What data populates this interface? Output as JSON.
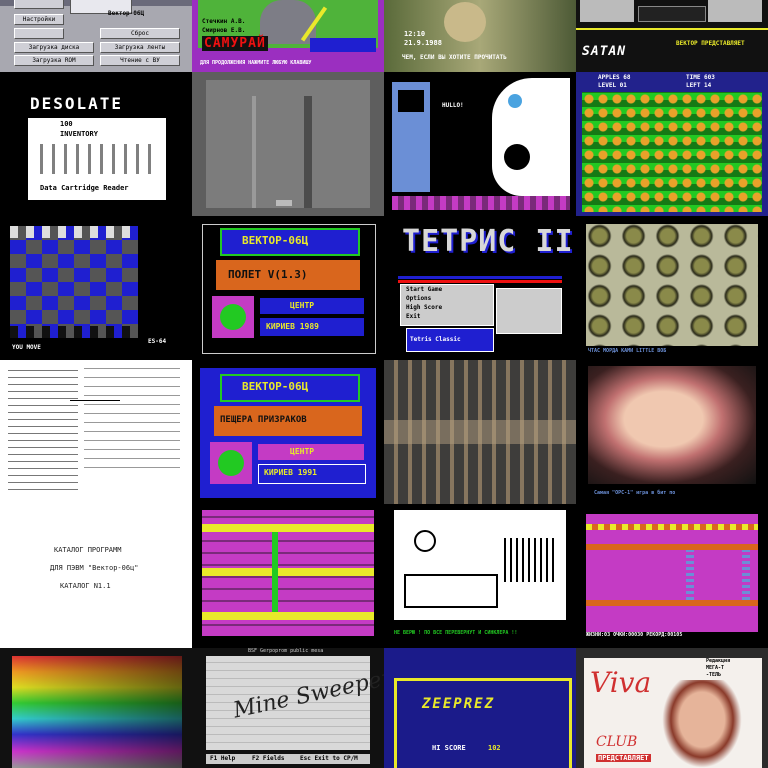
{
  "tiles": [
    {
      "id": "t1",
      "kind": "menu-screen",
      "title": "Вектор-06Ц",
      "buttons": [
        "Настройки",
        "Загрузка диска",
        "Загрузка ROM",
        "Сброс",
        "Загрузка ленты",
        "Чтение с ВУ"
      ]
    },
    {
      "id": "t2",
      "kind": "game",
      "title": "САМУРАЙ",
      "credits": [
        "Стечкин А.В.",
        "Смирнов Е.В."
      ],
      "ticker": "ДЛЯ ПРОДОЛЖЕНИЯ НАЖМИТЕ ЛЮБУЮ КЛАВИШУ"
    },
    {
      "id": "t3",
      "kind": "photo-screen",
      "clock": "12:10",
      "date": "21.9.1988",
      "caption": "ЧЕМ, ЕСЛИ ВЫ ХОТИТЕ ПРОЧИТАТЬ"
    },
    {
      "id": "t4",
      "kind": "game",
      "title": "SATAN",
      "subtitle": "ВЕКТОР ПРЕДСТАВЛЯЕТ"
    },
    {
      "id": "t5",
      "kind": "game",
      "title": "DESOLATE",
      "counter": "100",
      "panel_label": "INVENTORY",
      "item": "Data Cartridge Reader"
    },
    {
      "id": "t6",
      "kind": "game",
      "title": ""
    },
    {
      "id": "t7",
      "kind": "game",
      "speech": "HULLO!"
    },
    {
      "id": "t8",
      "kind": "game",
      "hud": [
        "APPLES 68",
        "TIME 603",
        "LEVEL 01",
        "LEFT 14"
      ]
    },
    {
      "id": "t9",
      "kind": "game",
      "status": "YOU MOVE",
      "side_label": "ES-64"
    },
    {
      "id": "t10",
      "kind": "game",
      "system": "ВЕКТОР-06Ц",
      "title": "ПОЛЕТ V(1.3)",
      "brand": "ЦЕНТР",
      "author": "КИРИЕВ 1989"
    },
    {
      "id": "t11",
      "kind": "game",
      "title": "ТЕТРИС II",
      "menu": [
        "Start Game",
        "Options",
        "High Score",
        "Exit"
      ],
      "footer": "Tetris Classic"
    },
    {
      "id": "t12",
      "kind": "game",
      "footer": "ЧТАС МОРДА КАМИ LITTLE ВОБ"
    },
    {
      "id": "t13",
      "kind": "document",
      "caption": "listing"
    },
    {
      "id": "t14",
      "kind": "game",
      "system": "ВЕКТОР-06Ц",
      "title": "ПЕЩЕРА ПРИЗРАКОВ",
      "brand": "ЦЕНТР",
      "author": "КИРИЕВ 1991"
    },
    {
      "id": "t15",
      "kind": "photo",
      "caption": "circuit board"
    },
    {
      "id": "t16",
      "kind": "picture",
      "caption": "Самая \"ОРС-1\" игра в бит по"
    },
    {
      "id": "t17",
      "kind": "document",
      "lines": [
        "КАТАЛОГ ПРОГРАММ",
        "ДЛЯ ПЭВМ \"Вектор-06ц\"",
        "КАТАЛОГ N1.1"
      ]
    },
    {
      "id": "t18",
      "kind": "game"
    },
    {
      "id": "t19",
      "kind": "game",
      "caption": "НЕ ВЕРЮ ! ПО ВСЕ ПЕРЕВЕРНУТ И СИНКЛЕРА !!"
    },
    {
      "id": "t20",
      "kind": "game",
      "hud": "ЖИЗНИ:03  ОЧКИ:00030  РЕКОРД:00105"
    },
    {
      "id": "t21",
      "kind": "palette"
    },
    {
      "id": "t22",
      "kind": "game",
      "header": "BSF Gerpoprom public mesa",
      "title": "Mine Sweeper",
      "menu": [
        "F1 Help",
        "F2 Fields",
        "Esc Exit to CP/M"
      ]
    },
    {
      "id": "t23",
      "kind": "game",
      "title": "ZEEPREZ",
      "score_label": "HI SCORE",
      "score": "102"
    },
    {
      "id": "t24",
      "kind": "magazine",
      "masthead": "Viva",
      "tag": "CLUB",
      "corner": [
        "Редакция",
        "МЕГА-Т",
        "-ТЕЛЬ"
      ],
      "footer": "ПРЕДСТАВЛЯЕТ"
    }
  ],
  "colors": {
    "bk_blue": "#1f1fd0",
    "bk_green": "#22c922",
    "bk_orange": "#d9661d",
    "bk_magenta": "#c43bc4",
    "bk_yellow": "#e9e92a"
  }
}
